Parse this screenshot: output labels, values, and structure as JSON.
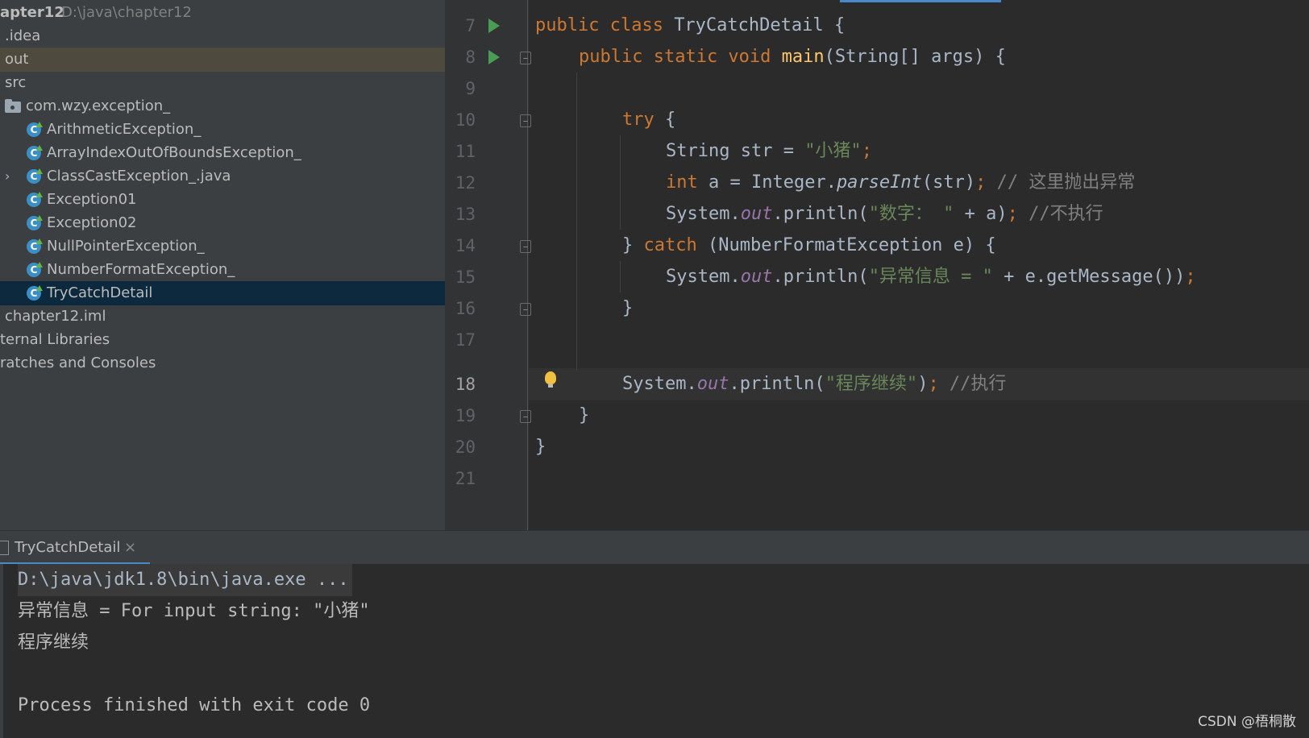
{
  "project": {
    "name": "apter12",
    "path": "D:\\java\\chapter12",
    "items": [
      {
        "label": ".idea"
      },
      {
        "label": "out",
        "highlighted": true
      },
      {
        "label": "src"
      },
      {
        "label": "com.wzy.exception_",
        "icon": "package-icon"
      },
      {
        "label": "ArithmeticException_",
        "icon": "java-class-icon"
      },
      {
        "label": "ArrayIndexOutOfBoundsException_",
        "icon": "java-class-icon"
      },
      {
        "label": "ClassCastException_.java",
        "icon": "java-class-icon",
        "expandable": true
      },
      {
        "label": "Exception01",
        "icon": "java-class-icon"
      },
      {
        "label": "Exception02",
        "icon": "java-class-icon"
      },
      {
        "label": "NullPointerException_",
        "icon": "java-class-icon"
      },
      {
        "label": "NumberFormatException_",
        "icon": "java-class-icon"
      },
      {
        "label": "TryCatchDetail",
        "icon": "java-class-icon",
        "selected": true
      },
      {
        "label": "chapter12.iml"
      },
      {
        "label": "ternal Libraries"
      },
      {
        "label": "ratches and Consoles"
      }
    ]
  },
  "editor": {
    "line_numbers": [
      "7",
      "8",
      "9",
      "10",
      "11",
      "12",
      "13",
      "14",
      "15",
      "16",
      "17",
      "18",
      "19",
      "20",
      "21"
    ],
    "current_line": "18",
    "code": {
      "l7": {
        "a": "public class ",
        "b": "TryCatchDetail {"
      },
      "l8": {
        "a": "public static void ",
        "b": "main",
        "c": "(String[] args) {"
      },
      "l10": {
        "a": "try",
        "b": " {"
      },
      "l11": {
        "a": "String str = ",
        "b": "\"小猪\"",
        "c": ";"
      },
      "l12": {
        "a": "int",
        "b": " a = Integer.",
        "c": "parseInt",
        "d": "(str)",
        "e": ";",
        "f": " // 这里抛出异常"
      },
      "l13": {
        "a": "System.",
        "b": "out",
        "c": ".println(",
        "d": "\"数字： \"",
        "e": " + a)",
        "f": ";",
        "g": " //不执行"
      },
      "l14": {
        "a": "} ",
        "b": "catch",
        "c": " (NumberFormatException e) {"
      },
      "l15": {
        "a": "System.",
        "b": "out",
        "c": ".println(",
        "d": "\"异常信息 = \"",
        "e": " + e.getMessage())",
        "f": ";"
      },
      "l16": {
        "a": "}"
      },
      "l18": {
        "a": "System.",
        "b": "out",
        "c": ".println(",
        "d": "\"程序继续\"",
        "e": ")",
        "f": ";",
        "g": " //执行"
      },
      "l19": {
        "a": "}"
      },
      "l20": {
        "a": "}"
      }
    }
  },
  "run_panel": {
    "tab_label": "TryCatchDetail",
    "close_glyph": "×",
    "output": [
      "D:\\java\\jdk1.8\\bin\\java.exe ...",
      "异常信息 = For input string: \"小猪\"",
      "程序继续",
      "",
      "Process finished with exit code 0"
    ]
  },
  "watermark": "CSDN @梧桐散",
  "colors": {
    "keyword": "#cc7832",
    "method": "#ffc66d",
    "string": "#6a8759",
    "comment": "#808080",
    "field": "#9876aa",
    "selection": "#0d293e",
    "run_gutter": "#499c54"
  }
}
